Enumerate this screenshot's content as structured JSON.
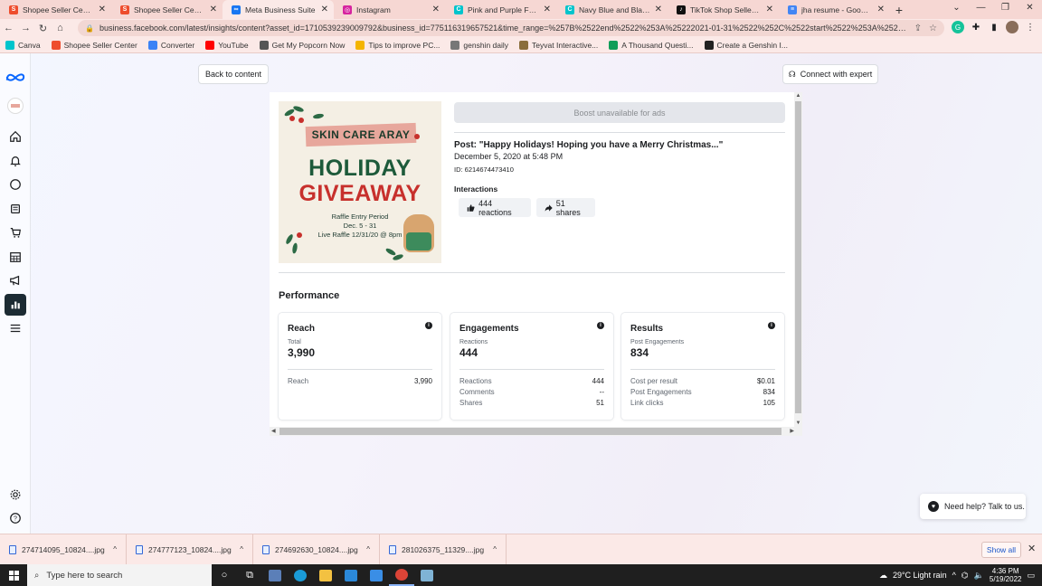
{
  "browser": {
    "tabs": [
      {
        "title": "Shopee Seller Center",
        "color": "#ee4d2d",
        "glyph": "S"
      },
      {
        "title": "Shopee Seller Center",
        "color": "#ee4d2d",
        "glyph": "S"
      },
      {
        "title": "Meta Business Suite",
        "color": "#1877f2",
        "glyph": "∞"
      },
      {
        "title": "Instagram",
        "color": "#d6249f",
        "glyph": "◎"
      },
      {
        "title": "Pink and Purple Feminine",
        "color": "#00c4cc",
        "glyph": "C"
      },
      {
        "title": "Navy Blue and Black Profe",
        "color": "#00c4cc",
        "glyph": "C"
      },
      {
        "title": "TikTok Shop Seller Sign Up",
        "color": "#111111",
        "glyph": "♪"
      },
      {
        "title": "jha resume - Google Docs",
        "color": "#4285f4",
        "glyph": "≡"
      }
    ],
    "active_tab": 2,
    "url": "business.facebook.com/latest/insights/content?asset_id=1710539239009792&business_id=775116319657521&time_range=%257B%2522end%2522%253A%25222021-01-31%2522%252C%2522start%2522%253A%25222020-10-01%2522%25...",
    "bookmarks": [
      {
        "label": "Canva",
        "color": "#00c4cc"
      },
      {
        "label": "Shopee Seller Center",
        "color": "#ee4d2d"
      },
      {
        "label": "Converter",
        "color": "#3b82f6"
      },
      {
        "label": "YouTube",
        "color": "#ff0000"
      },
      {
        "label": "Get My Popcorn Now",
        "color": "#555555"
      },
      {
        "label": "Tips to improve PC...",
        "color": "#f4b400"
      },
      {
        "label": "genshin daily",
        "color": "#777777"
      },
      {
        "label": "Teyvat Interactive...",
        "color": "#8a6d3b"
      },
      {
        "label": "A Thousand Questi...",
        "color": "#0f9d58"
      },
      {
        "label": "Create a Genshin I...",
        "color": "#222222"
      }
    ]
  },
  "toolbar": {
    "back_label": "Back to content",
    "expert_label": "Connect with expert"
  },
  "post": {
    "boost_label": "Boost unavailable for ads",
    "title": "Post: \"Happy Holidays! Hoping you have a Merry Christmas...\"",
    "date": "December 5, 2020 at 5:48 PM",
    "id": "ID: 6214674473410",
    "interactions_label": "Interactions",
    "reactions_chip": "444 reactions",
    "shares_chip": "51 shares",
    "image": {
      "brand": "SKIN CARE ARAY",
      "line1": "HOLIDAY",
      "line2": "GIVEAWAY",
      "raffle1": "Raffle Entry Period",
      "raffle2": "Dec. 5 - 31",
      "raffle3": "Live Raffle 12/31/20 @ 8pm"
    }
  },
  "performance": {
    "heading": "Performance",
    "cards": [
      {
        "title": "Reach",
        "sub": "Total",
        "value": "3,990",
        "rows": [
          {
            "label": "Reach",
            "value": "3,990"
          }
        ]
      },
      {
        "title": "Engagements",
        "sub": "Reactions",
        "value": "444",
        "rows": [
          {
            "label": "Reactions",
            "value": "444"
          },
          {
            "label": "Comments",
            "value": "--"
          },
          {
            "label": "Shares",
            "value": "51"
          }
        ]
      },
      {
        "title": "Results",
        "sub": "Post Engagements",
        "value": "834",
        "rows": [
          {
            "label": "Cost per result",
            "value": "$0.01"
          },
          {
            "label": "Post Engagements",
            "value": "834"
          },
          {
            "label": "Link clicks",
            "value": "105"
          }
        ]
      }
    ]
  },
  "help": {
    "label": "Need help? Talk to us."
  },
  "downloads": {
    "files": [
      "274714095_10824....jpg",
      "274777123_10824....jpg",
      "274692630_10824....jpg",
      "281026375_11329....jpg"
    ],
    "show_all": "Show all"
  },
  "taskbar": {
    "search_placeholder": "Type here to search",
    "weather": "29°C  Light rain",
    "time": "4:36 PM",
    "date": "5/19/2022"
  }
}
